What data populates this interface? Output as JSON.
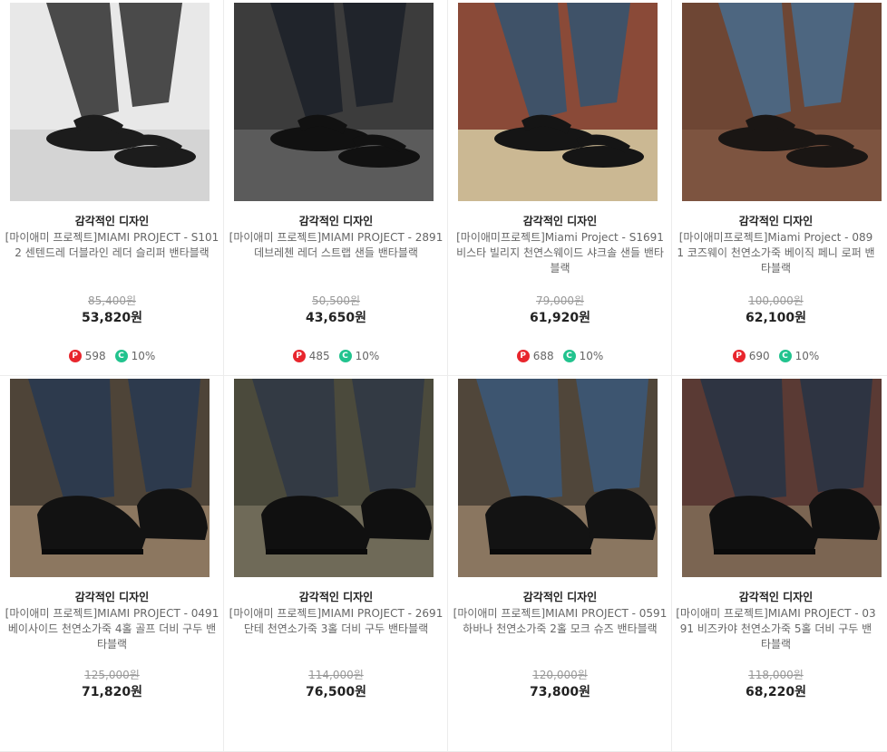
{
  "products": [
    {
      "subtitle": "감각적인 디자인",
      "name": "[마이애미 프로젝트]MIAMI PROJECT - S1012 센텐드레 더블라인 레더 슬리퍼 밴타블랙",
      "original_price": "85,400원",
      "price": "53,820원",
      "points": "598",
      "coupon": "10%",
      "image": {
        "bg": "#e8e8e8",
        "floor": "#d4d4d4",
        "pants": "#4a4a4a",
        "shoe": "#1c1c1c"
      }
    },
    {
      "subtitle": "감각적인 디자인",
      "name": "[마이애미 프로젝트]MIAMI PROJECT - 2891 데브레첸 레더 스트랩 샌들 밴타블랙",
      "original_price": "50,500원",
      "price": "43,650원",
      "points": "485",
      "coupon": "10%",
      "image": {
        "bg": "#3c3c3c",
        "floor": "#5b5b5b",
        "pants": "#20242b",
        "shoe": "#111111"
      }
    },
    {
      "subtitle": "감각적인 디자인",
      "name": "[마이애미프로젝트]Miami Project - S1691 비스타 빌리지 천연스웨이드 샤크솔 샌들 밴타블랙",
      "original_price": "79,000원",
      "price": "61,920원",
      "points": "688",
      "coupon": "10%",
      "image": {
        "bg": "#8a4a38",
        "floor": "#cbb893",
        "pants": "#3f5268",
        "shoe": "#151515"
      }
    },
    {
      "subtitle": "감각적인 디자인",
      "name": "[마이애미프로젝트]Miami Project - 0891 코즈웨이 천연소가죽 베이직 페니 로퍼 밴타블랙",
      "original_price": "100,000원",
      "price": "62,100원",
      "points": "690",
      "coupon": "10%",
      "image": {
        "bg": "#6e4634",
        "floor": "#7d5440",
        "pants": "#4d6680",
        "shoe": "#1a1614"
      }
    },
    {
      "subtitle": "감각적인 디자인",
      "name": "[마이애미 프로젝트]MIAMI PROJECT - 0491 베이사이드 천연소가죽 4홀 골프 더비 구두 밴타블랙",
      "original_price": "125,000원",
      "price": "71,820원",
      "points": "",
      "coupon": "",
      "image": {
        "bg": "#4e4438",
        "floor": "#8c7760",
        "pants": "#2d3a4d",
        "shoe": "#121212"
      }
    },
    {
      "subtitle": "감각적인 디자인",
      "name": "[마이애미 프로젝트]MIAMI PROJECT - 2691 단테 천연소가죽 3홀 더비 구두 밴타블랙",
      "original_price": "114,000원",
      "price": "76,500원",
      "points": "",
      "coupon": "",
      "image": {
        "bg": "#4b4a3c",
        "floor": "#6f6a58",
        "pants": "#333a44",
        "shoe": "#101010"
      }
    },
    {
      "subtitle": "감각적인 디자인",
      "name": "[마이애미 프로젝트]MIAMI PROJECT - 0591 하바나 천연소가죽 2홀 모크 슈즈 밴타블랙",
      "original_price": "120,000원",
      "price": "73,800원",
      "points": "",
      "coupon": "",
      "image": {
        "bg": "#50463a",
        "floor": "#8a7660",
        "pants": "#3d5570",
        "shoe": "#131313"
      }
    },
    {
      "subtitle": "감각적인 디자인",
      "name": "[마이애미 프로젝트]MIAMI PROJECT - 0391 비즈카야 천연소가죽 5홀 더비 구두 밴타블랙",
      "original_price": "118,000원",
      "price": "68,220원",
      "points": "",
      "coupon": "",
      "image": {
        "bg": "#5a3a34",
        "floor": "#7b6552",
        "pants": "#2e3442",
        "shoe": "#101010"
      }
    }
  ],
  "icons": {
    "point_badge": "P",
    "coupon_badge": "C"
  },
  "colors": {
    "point": "#e8262d",
    "coupon": "#22c38e",
    "strike": "#999999"
  }
}
